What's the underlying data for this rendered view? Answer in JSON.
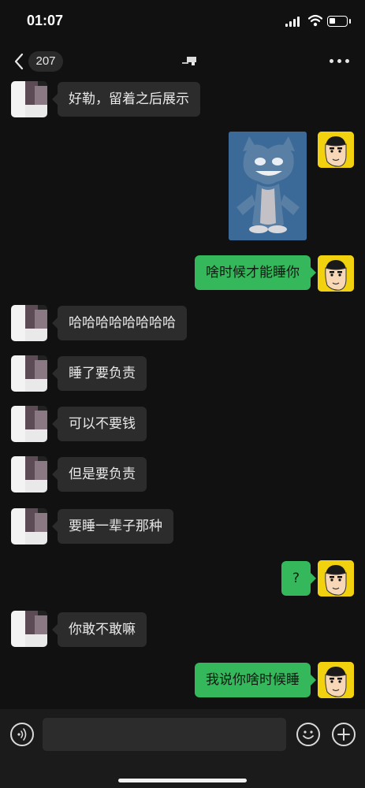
{
  "status_bar": {
    "time": "01:07",
    "battery_icon": "battery-icon",
    "wifi_icon": "wifi-icon",
    "signal_icon": "signal-icon"
  },
  "nav": {
    "unread_count": "207",
    "back_icon": "chevron-left-icon",
    "more_icon": "more-dots-icon"
  },
  "messages": [
    {
      "side": "left",
      "text": "好勒，留着之后展示"
    },
    {
      "side": "right",
      "type": "sticker",
      "sticker": "tom-cat-sticker"
    },
    {
      "side": "right",
      "text": "啥时候才能睡你"
    },
    {
      "side": "left",
      "text": "哈哈哈哈哈哈哈哈"
    },
    {
      "side": "left",
      "text": "睡了要负责"
    },
    {
      "side": "left",
      "text": "可以不要钱"
    },
    {
      "side": "left",
      "text": "但是要负责"
    },
    {
      "side": "left",
      "text": "要睡一辈子那种"
    },
    {
      "side": "right",
      "text": "?"
    },
    {
      "side": "left",
      "text": "你敢不敢嘛"
    },
    {
      "side": "right",
      "text": "我说你啥时候睡"
    }
  ],
  "input_bar": {
    "voice_icon": "voice-icon",
    "emoji_icon": "emoji-icon",
    "plus_icon": "plus-icon",
    "input_value": ""
  },
  "colors": {
    "background": "#111111",
    "bubble_left": "#2c2c2c",
    "bubble_right": "#35b75b",
    "avatar_right_bg": "#f2d10e"
  }
}
